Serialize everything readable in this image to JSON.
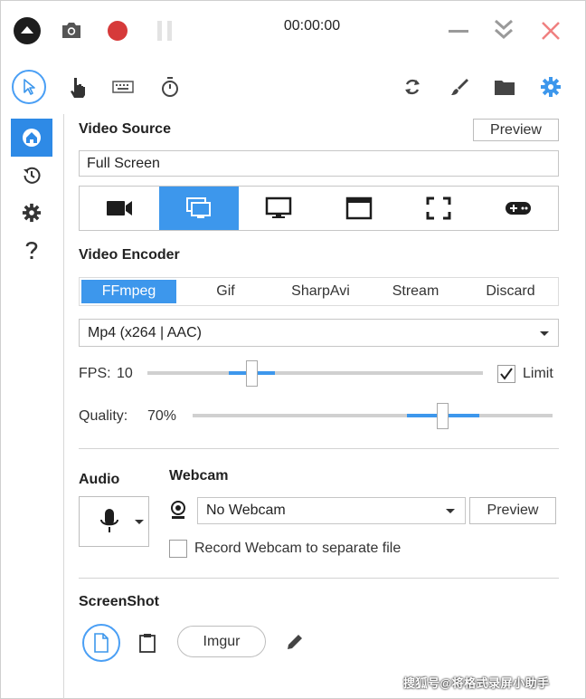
{
  "titlebar": {
    "timer": "00:00:00"
  },
  "colors": {
    "accent": "#3d97ec",
    "record": "#d63a3a",
    "close": "#f08080"
  },
  "video_source": {
    "title": "Video Source",
    "preview_label": "Preview",
    "source_value": "Full Screen",
    "modes": [
      "camera-icon",
      "screen-region-icon",
      "monitor-icon",
      "window-icon",
      "fullscreen-icon",
      "gamepad-icon"
    ],
    "active_mode": 1
  },
  "video_encoder": {
    "title": "Video Encoder",
    "tabs": [
      "FFmpeg",
      "Gif",
      "SharpAvi",
      "Stream",
      "Discard"
    ],
    "active_tab": 0,
    "codec": "Mp4 (x264 | AAC)"
  },
  "fps": {
    "label": "FPS:",
    "value": "10",
    "limit_label": "Limit",
    "limit_checked": true
  },
  "quality": {
    "label": "Quality:",
    "value": "70%"
  },
  "audio": {
    "title": "Audio"
  },
  "webcam": {
    "title": "Webcam",
    "selected": "No Webcam",
    "preview_label": "Preview",
    "separate_file_label": "Record Webcam to separate file",
    "separate_file_checked": false
  },
  "screenshot": {
    "title": "ScreenShot",
    "imgur_label": "Imgur"
  },
  "watermark": "搜狐号@将格式录屏小助手"
}
